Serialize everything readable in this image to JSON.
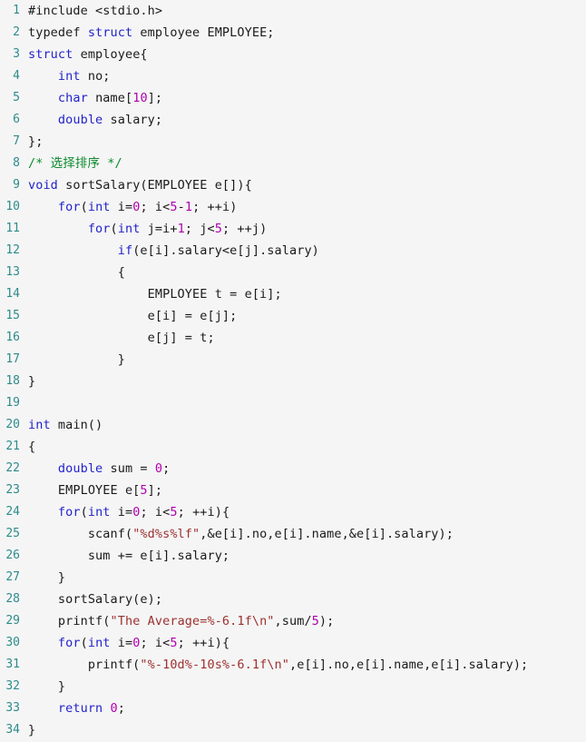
{
  "editor": {
    "language": "C",
    "total_lines": 34,
    "background_color": "#f5f5f5",
    "gutter_color": "#2e8b8b",
    "colors": {
      "keyword": "#2222cc",
      "number": "#b000b0",
      "string": "#9c3030",
      "comment": "#0b8a2e",
      "default": "#1a1a1a"
    }
  },
  "lines": [
    {
      "n": "1",
      "tokens": [
        {
          "t": "#include <stdio.h>",
          "c": "pre"
        }
      ]
    },
    {
      "n": "2",
      "tokens": [
        {
          "t": "typedef ",
          "c": "def"
        },
        {
          "t": "struct",
          "c": "kw"
        },
        {
          "t": " employee EMPLOYEE;",
          "c": "def"
        }
      ]
    },
    {
      "n": "3",
      "tokens": [
        {
          "t": "struct",
          "c": "kw"
        },
        {
          "t": " employee{",
          "c": "def"
        }
      ]
    },
    {
      "n": "4",
      "tokens": [
        {
          "t": "    ",
          "c": "def"
        },
        {
          "t": "int",
          "c": "kw"
        },
        {
          "t": " no;",
          "c": "def"
        }
      ]
    },
    {
      "n": "5",
      "tokens": [
        {
          "t": "    ",
          "c": "def"
        },
        {
          "t": "char",
          "c": "kw"
        },
        {
          "t": " name[",
          "c": "def"
        },
        {
          "t": "10",
          "c": "num"
        },
        {
          "t": "];",
          "c": "def"
        }
      ]
    },
    {
      "n": "6",
      "tokens": [
        {
          "t": "    ",
          "c": "def"
        },
        {
          "t": "double",
          "c": "kw"
        },
        {
          "t": " salary;",
          "c": "def"
        }
      ]
    },
    {
      "n": "7",
      "tokens": [
        {
          "t": "};",
          "c": "def"
        }
      ]
    },
    {
      "n": "8",
      "tokens": [
        {
          "t": "/* 选择排序 */",
          "c": "com"
        }
      ]
    },
    {
      "n": "9",
      "tokens": [
        {
          "t": "void",
          "c": "kw"
        },
        {
          "t": " sortSalary(EMPLOYEE e[]){",
          "c": "def"
        }
      ]
    },
    {
      "n": "10",
      "tokens": [
        {
          "t": "    ",
          "c": "def"
        },
        {
          "t": "for",
          "c": "kw"
        },
        {
          "t": "(",
          "c": "def"
        },
        {
          "t": "int",
          "c": "kw"
        },
        {
          "t": " i=",
          "c": "def"
        },
        {
          "t": "0",
          "c": "num"
        },
        {
          "t": "; i<",
          "c": "def"
        },
        {
          "t": "5",
          "c": "num"
        },
        {
          "t": "-",
          "c": "def"
        },
        {
          "t": "1",
          "c": "num"
        },
        {
          "t": "; ++i)",
          "c": "def"
        }
      ]
    },
    {
      "n": "11",
      "tokens": [
        {
          "t": "        ",
          "c": "def"
        },
        {
          "t": "for",
          "c": "kw"
        },
        {
          "t": "(",
          "c": "def"
        },
        {
          "t": "int",
          "c": "kw"
        },
        {
          "t": " j=i+",
          "c": "def"
        },
        {
          "t": "1",
          "c": "num"
        },
        {
          "t": "; j<",
          "c": "def"
        },
        {
          "t": "5",
          "c": "num"
        },
        {
          "t": "; ++j)",
          "c": "def"
        }
      ]
    },
    {
      "n": "12",
      "tokens": [
        {
          "t": "            ",
          "c": "def"
        },
        {
          "t": "if",
          "c": "kw"
        },
        {
          "t": "(e[i].salary<e[j].salary)",
          "c": "def"
        }
      ]
    },
    {
      "n": "13",
      "tokens": [
        {
          "t": "            {",
          "c": "def"
        }
      ]
    },
    {
      "n": "14",
      "tokens": [
        {
          "t": "                EMPLOYEE t = e[i];",
          "c": "def"
        }
      ]
    },
    {
      "n": "15",
      "tokens": [
        {
          "t": "                e[i] = e[j];",
          "c": "def"
        }
      ]
    },
    {
      "n": "16",
      "tokens": [
        {
          "t": "                e[j] = t;",
          "c": "def"
        }
      ]
    },
    {
      "n": "17",
      "tokens": [
        {
          "t": "            }",
          "c": "def"
        }
      ]
    },
    {
      "n": "18",
      "tokens": [
        {
          "t": "}",
          "c": "def"
        }
      ]
    },
    {
      "n": "19",
      "tokens": [
        {
          "t": "",
          "c": "def"
        }
      ]
    },
    {
      "n": "20",
      "tokens": [
        {
          "t": "int",
          "c": "kw"
        },
        {
          "t": " main()",
          "c": "def"
        }
      ]
    },
    {
      "n": "21",
      "tokens": [
        {
          "t": "{",
          "c": "def"
        }
      ]
    },
    {
      "n": "22",
      "tokens": [
        {
          "t": "    ",
          "c": "def"
        },
        {
          "t": "double",
          "c": "kw"
        },
        {
          "t": " sum = ",
          "c": "def"
        },
        {
          "t": "0",
          "c": "num"
        },
        {
          "t": ";",
          "c": "def"
        }
      ]
    },
    {
      "n": "23",
      "tokens": [
        {
          "t": "    EMPLOYEE e[",
          "c": "def"
        },
        {
          "t": "5",
          "c": "num"
        },
        {
          "t": "];",
          "c": "def"
        }
      ]
    },
    {
      "n": "24",
      "tokens": [
        {
          "t": "    ",
          "c": "def"
        },
        {
          "t": "for",
          "c": "kw"
        },
        {
          "t": "(",
          "c": "def"
        },
        {
          "t": "int",
          "c": "kw"
        },
        {
          "t": " i=",
          "c": "def"
        },
        {
          "t": "0",
          "c": "num"
        },
        {
          "t": "; i<",
          "c": "def"
        },
        {
          "t": "5",
          "c": "num"
        },
        {
          "t": "; ++i){",
          "c": "def"
        }
      ]
    },
    {
      "n": "25",
      "tokens": [
        {
          "t": "        scanf(",
          "c": "def"
        },
        {
          "t": "\"%d%s%lf\"",
          "c": "str"
        },
        {
          "t": ",&e[i].no,e[i].name,&e[i].salary);",
          "c": "def"
        }
      ]
    },
    {
      "n": "26",
      "tokens": [
        {
          "t": "        sum += e[i].salary;",
          "c": "def"
        }
      ]
    },
    {
      "n": "27",
      "tokens": [
        {
          "t": "    }",
          "c": "def"
        }
      ]
    },
    {
      "n": "28",
      "tokens": [
        {
          "t": "    sortSalary(e);",
          "c": "def"
        }
      ]
    },
    {
      "n": "29",
      "tokens": [
        {
          "t": "    printf(",
          "c": "def"
        },
        {
          "t": "\"The Average=%-6.1f\\n\"",
          "c": "str"
        },
        {
          "t": ",sum/",
          "c": "def"
        },
        {
          "t": "5",
          "c": "num"
        },
        {
          "t": ");",
          "c": "def"
        }
      ]
    },
    {
      "n": "30",
      "tokens": [
        {
          "t": "    ",
          "c": "def"
        },
        {
          "t": "for",
          "c": "kw"
        },
        {
          "t": "(",
          "c": "def"
        },
        {
          "t": "int",
          "c": "kw"
        },
        {
          "t": " i=",
          "c": "def"
        },
        {
          "t": "0",
          "c": "num"
        },
        {
          "t": "; i<",
          "c": "def"
        },
        {
          "t": "5",
          "c": "num"
        },
        {
          "t": "; ++i){",
          "c": "def"
        }
      ]
    },
    {
      "n": "31",
      "tokens": [
        {
          "t": "        printf(",
          "c": "def"
        },
        {
          "t": "\"%-10d%-10s%-6.1f\\n\"",
          "c": "str"
        },
        {
          "t": ",e[i].no,e[i].name,e[i].salary);",
          "c": "def"
        }
      ]
    },
    {
      "n": "32",
      "tokens": [
        {
          "t": "    }",
          "c": "def"
        }
      ]
    },
    {
      "n": "33",
      "tokens": [
        {
          "t": "    ",
          "c": "def"
        },
        {
          "t": "return",
          "c": "kw"
        },
        {
          "t": " ",
          "c": "def"
        },
        {
          "t": "0",
          "c": "num"
        },
        {
          "t": ";",
          "c": "def"
        }
      ]
    },
    {
      "n": "34",
      "tokens": [
        {
          "t": "}",
          "c": "def"
        }
      ]
    }
  ]
}
